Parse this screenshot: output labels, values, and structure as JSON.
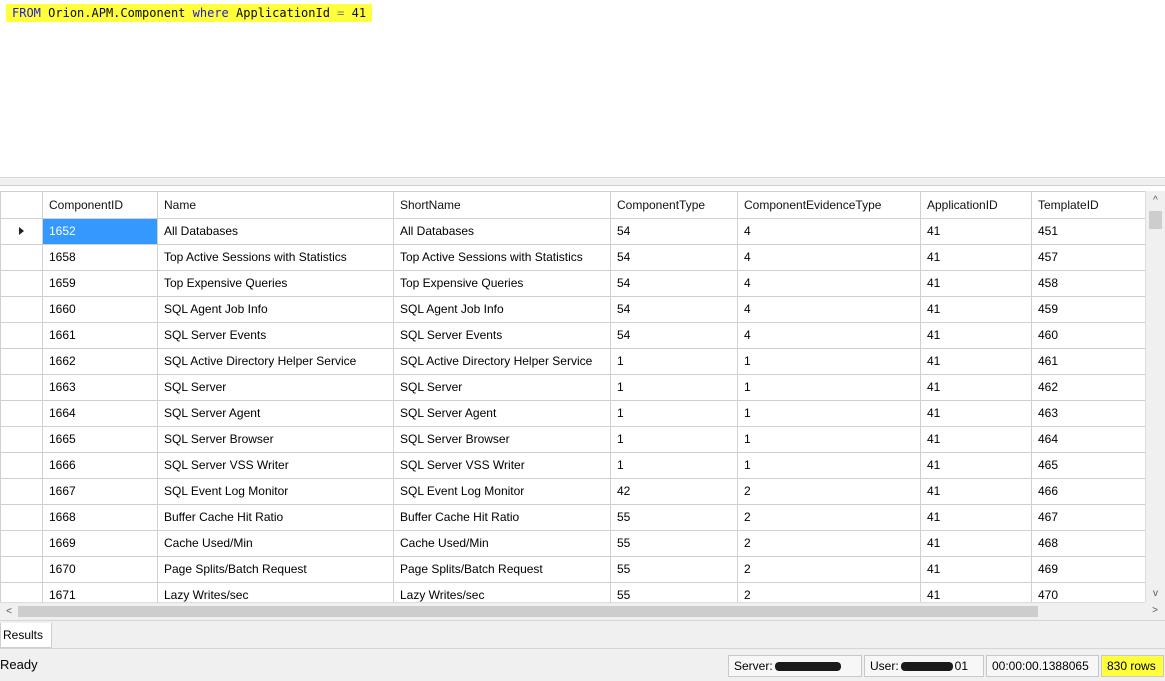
{
  "editor": {
    "query": {
      "from": "FROM",
      "object": "Orion.APM.Component",
      "where": "where",
      "field": "ApplicationId",
      "operator": "=",
      "value": "41"
    }
  },
  "grid": {
    "columns": [
      "ComponentID",
      "Name",
      "ShortName",
      "ComponentType",
      "ComponentEvidenceType",
      "ApplicationID",
      "TemplateID"
    ],
    "rows": [
      [
        "1652",
        "All Databases",
        "All Databases",
        "54",
        "4",
        "41",
        "451"
      ],
      [
        "1658",
        "Top Active Sessions with Statistics",
        "Top Active Sessions with Statistics",
        "54",
        "4",
        "41",
        "457"
      ],
      [
        "1659",
        "Top Expensive Queries",
        "Top Expensive Queries",
        "54",
        "4",
        "41",
        "458"
      ],
      [
        "1660",
        "SQL Agent Job Info",
        "SQL Agent Job Info",
        "54",
        "4",
        "41",
        "459"
      ],
      [
        "1661",
        "SQL Server Events",
        "SQL Server Events",
        "54",
        "4",
        "41",
        "460"
      ],
      [
        "1662",
        "SQL Active Directory Helper Service",
        "SQL Active Directory Helper Service",
        "1",
        "1",
        "41",
        "461"
      ],
      [
        "1663",
        "SQL Server",
        "SQL Server",
        "1",
        "1",
        "41",
        "462"
      ],
      [
        "1664",
        "SQL Server Agent",
        "SQL Server Agent",
        "1",
        "1",
        "41",
        "463"
      ],
      [
        "1665",
        "SQL Server Browser",
        "SQL Server Browser",
        "1",
        "1",
        "41",
        "464"
      ],
      [
        "1666",
        "SQL Server VSS Writer",
        "SQL Server VSS Writer",
        "1",
        "1",
        "41",
        "465"
      ],
      [
        "1667",
        "SQL Event Log Monitor",
        "SQL Event Log Monitor",
        "42",
        "2",
        "41",
        "466"
      ],
      [
        "1668",
        "Buffer Cache Hit Ratio",
        "Buffer Cache Hit Ratio",
        "55",
        "2",
        "41",
        "467"
      ],
      [
        "1669",
        "Cache Used/Min",
        "Cache Used/Min",
        "55",
        "2",
        "41",
        "468"
      ],
      [
        "1670",
        "Page Splits/Batch Request",
        "Page Splits/Batch Request",
        "55",
        "2",
        "41",
        "469"
      ],
      [
        "1671",
        "Lazy Writes/sec",
        "Lazy Writes/sec",
        "55",
        "2",
        "41",
        "470"
      ]
    ],
    "selected_row": 0
  },
  "scroll": {
    "up": "^",
    "down": "v",
    "left": "<",
    "right": ">"
  },
  "tabs": {
    "results": "Results"
  },
  "status": {
    "ready": "Ready",
    "server_label": "Server:",
    "user_label": "User:",
    "user_suffix": "01",
    "elapsed": "00:00:00.1388065",
    "rows": "830 rows"
  },
  "colors": {
    "highlight": "#ffff3c",
    "selection": "#3399ff"
  }
}
